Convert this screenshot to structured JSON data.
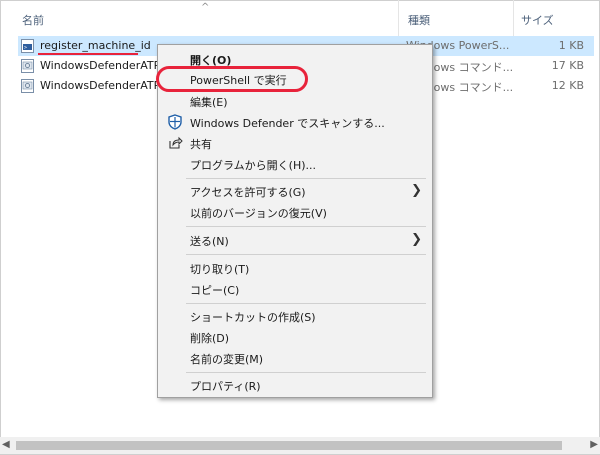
{
  "columns": {
    "name": "名前",
    "type": "種類",
    "size": "サイズ"
  },
  "files": [
    {
      "name": "register_machine_id",
      "type": "Windows PowerS...",
      "size": "1 KB",
      "selected": true
    },
    {
      "name": "WindowsDefenderATPL",
      "type": "Windows コマンド...",
      "size": "17 KB",
      "selected": false
    },
    {
      "name": "WindowsDefenderATPL",
      "type": "Windows コマンド...",
      "size": "12 KB",
      "selected": false
    }
  ],
  "menu": {
    "open": "開く(O)",
    "run_powershell": "PowerShell で実行",
    "edit": "編集(E)",
    "defender_scan": "Windows Defender でスキャンする...",
    "share": "共有",
    "open_with": "プログラムから開く(H)...",
    "give_access": "アクセスを許可する(G)",
    "restore_versions": "以前のバージョンの復元(V)",
    "send_to": "送る(N)",
    "cut": "切り取り(T)",
    "copy": "コピー(C)",
    "create_shortcut": "ショートカットの作成(S)",
    "delete": "削除(D)",
    "rename": "名前の変更(M)",
    "properties": "プロパティ(R)"
  },
  "colors": {
    "selection": "#cce8ff",
    "annotation_red": "#e8233b",
    "header_text": "#4c607a"
  }
}
